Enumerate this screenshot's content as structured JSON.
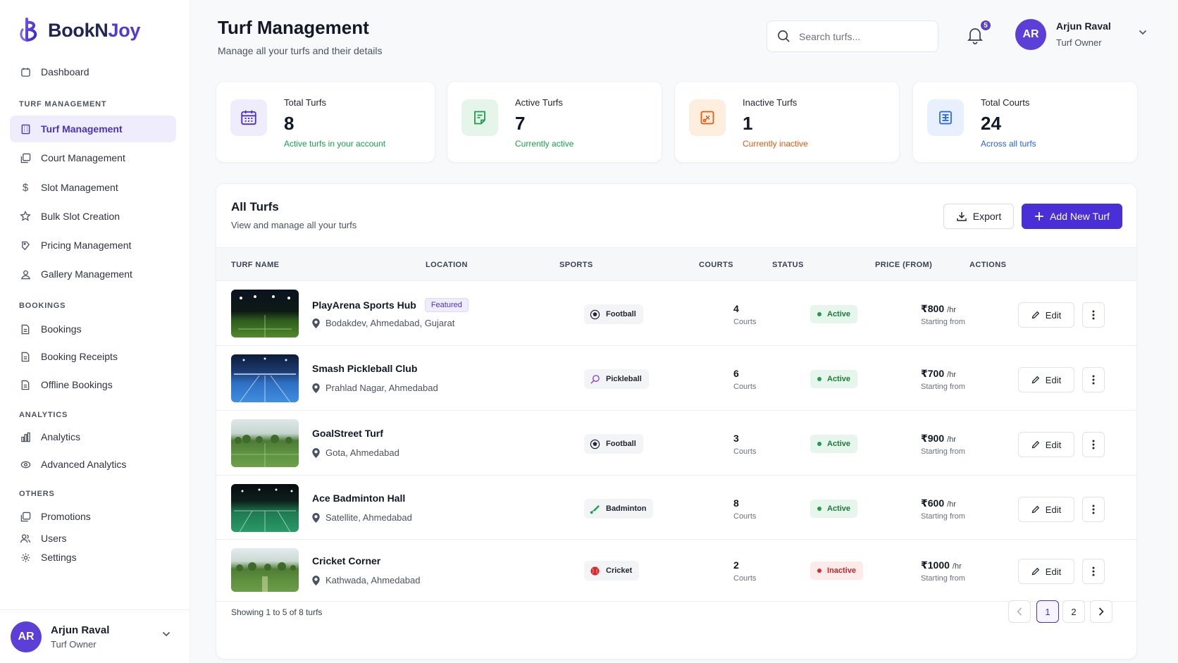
{
  "brand": {
    "name_a": "BookN",
    "name_b": "Joy",
    "accent": "#4f3ad8"
  },
  "sidebar": {
    "dashboard": "Dashboard",
    "sections": {
      "turf": "TURF MANAGEMENT",
      "bookings": "BOOKINGS",
      "analytics": "ANALYTICS",
      "others": "OTHERS"
    },
    "items": {
      "turf_management": "Turf Management",
      "court_management": "Court Management",
      "slot_management": "Slot Management",
      "bulk_slot_creation": "Bulk Slot Creation",
      "pricing_management": "Pricing Management",
      "gallery_management": "Gallery Management",
      "bookings": "Bookings",
      "booking_receipts": "Booking Receipts",
      "offline_bookings": "Offline Bookings",
      "analytics": "Analytics",
      "advanced_analytics": "Advanced Analytics",
      "promotions": "Promotions",
      "users": "Users",
      "settings": "Settings"
    },
    "user": {
      "initials": "AR",
      "name": "Arjun Raval",
      "role": "Turf Owner"
    }
  },
  "header": {
    "title": "Turf Management",
    "subtitle": "Manage all your turfs and their details",
    "search_placeholder": "Search turfs...",
    "notifications": "5",
    "user": {
      "initials": "AR",
      "name": "Arjun Raval",
      "role": "Turf Owner"
    }
  },
  "stats": [
    {
      "label": "Total Turfs",
      "value": "8",
      "note": "Active turfs in your account",
      "color": "#16a34a",
      "icon": "calendar-icon"
    },
    {
      "label": "Active Turfs",
      "value": "7",
      "note": "Currently active",
      "color": "#16a34a",
      "icon": "receipt-icon"
    },
    {
      "label": "Inactive Turfs",
      "value": "1",
      "note": "Currently inactive",
      "color": "#ea580c",
      "icon": "pause-card-icon"
    },
    {
      "label": "Total Courts",
      "value": "24",
      "note": "Across all turfs",
      "color": "#2563eb",
      "icon": "court-grid-icon"
    }
  ],
  "table": {
    "title": "All Turfs",
    "subtitle": "View and manage all your turfs",
    "export_label": "Export",
    "add_label": "Add New Turf",
    "columns": {
      "name": "TURF NAME",
      "location": "LOCATION",
      "sports": "SPORTS",
      "courts": "COURTS",
      "status": "STATUS",
      "price": "PRICE (FROM)",
      "actions": "ACTIONS"
    },
    "courts_label": "Courts",
    "price_unit": "/hr",
    "price_note": "Starting from",
    "edit_label": "Edit",
    "rows": [
      {
        "name": "PlayArena Sports Hub",
        "badge": "Featured",
        "location": "Bodakdev, Ahmedabad, Gujarat",
        "sport": "Football",
        "courts": "4",
        "status": "Active",
        "price": "₹800"
      },
      {
        "name": "Smash Pickleball Club",
        "location": "Prahlad Nagar, Ahmedabad",
        "sport": "Pickleball",
        "courts": "6",
        "status": "Active",
        "price": "₹700"
      },
      {
        "name": "GoalStreet Turf",
        "location": "Gota, Ahmedabad",
        "sport": "Football",
        "courts": "3",
        "status": "Active",
        "price": "₹900"
      },
      {
        "name": "Ace Badminton Hall",
        "location": "Satellite, Ahmedabad",
        "sport": "Badminton",
        "courts": "8",
        "status": "Active",
        "price": "₹600"
      },
      {
        "name": "Cricket Corner",
        "location": "Kathwada, Ahmedabad",
        "sport": "Cricket",
        "courts": "2",
        "status": "Inactive",
        "price": "₹1000"
      }
    ],
    "footer": "Showing 1 to 5 of 8 turfs",
    "pages": [
      "1",
      "2"
    ]
  }
}
